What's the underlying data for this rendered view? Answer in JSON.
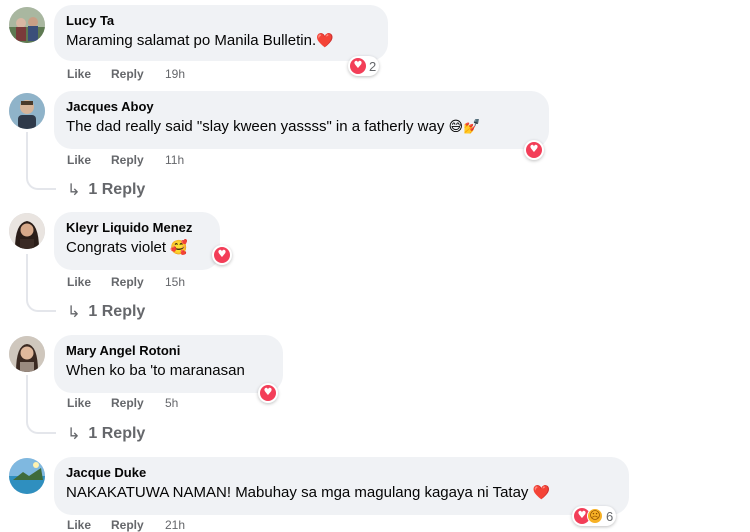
{
  "comments": [
    {
      "author": "Lucy Ta",
      "text": "Maraming salamat po Manila Bulletin.",
      "emoji": "❤️",
      "reactions": {
        "icons": [
          "heart-icon"
        ],
        "count": "2"
      },
      "like": "Like",
      "reply": "Reply",
      "time": "19h"
    },
    {
      "author": "Jacques Aboy",
      "text": "The dad really said \"slay kween yassss\" in a fatherly way",
      "emoji": "😅💅",
      "reactions": {
        "icons": [
          "heart-icon"
        ],
        "count": ""
      },
      "like": "Like",
      "reply": "Reply",
      "time": "11h",
      "replies": "1 Reply"
    },
    {
      "author": "Kleyr Liquido Menez",
      "text": "Congrats violet",
      "emoji": "🥰",
      "reactions": {
        "icons": [
          "heart-icon"
        ],
        "count": ""
      },
      "like": "Like",
      "reply": "Reply",
      "time": "15h",
      "replies": "1 Reply"
    },
    {
      "author": "Mary Angel Rotoni",
      "text": "When ko ba 'to maranasan",
      "emoji": "",
      "reactions": {
        "icons": [
          "heart-icon"
        ],
        "count": ""
      },
      "like": "Like",
      "reply": "Reply",
      "time": "5h",
      "replies": "1 Reply"
    },
    {
      "author": "Jacque Duke",
      "text": "NAKAKATUWA NAMAN! Mabuhay sa mga magulang kagaya ni Tatay",
      "emoji": "❤️",
      "reactions": {
        "icons": [
          "heart-icon",
          "sad-icon"
        ],
        "count": "6"
      },
      "like": "Like",
      "reply": "Reply",
      "time": "21h"
    }
  ],
  "colors": {
    "bubble": "#f0f2f5",
    "meta_text": "#65676b",
    "love_reaction": "#f33e58",
    "sad_reaction": "#f7b125"
  }
}
